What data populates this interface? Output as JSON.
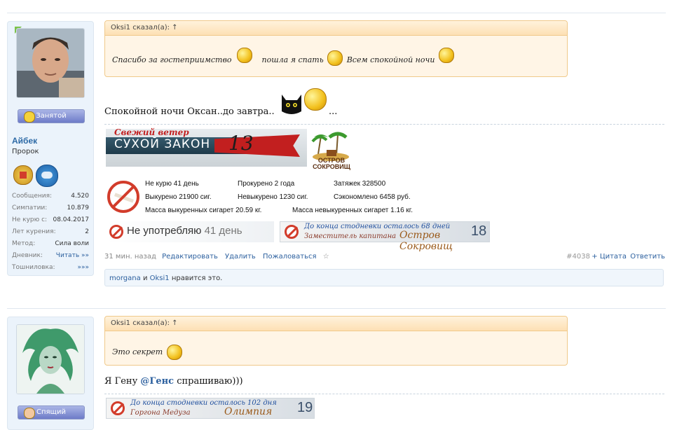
{
  "post1": {
    "user": {
      "status_label": "Занятой",
      "name": "Айбек",
      "title": "Пророк",
      "stats": [
        {
          "label": "Сообщения:",
          "value": "4.520"
        },
        {
          "label": "Симпатии:",
          "value": "10.879"
        },
        {
          "label": "Не курю с:",
          "value": "08.04.2017"
        },
        {
          "label": "Лет курения:",
          "value": "2"
        },
        {
          "label": "Метод:",
          "value": "Сила воли"
        },
        {
          "label": "Дневник:",
          "value": "Читать »»"
        },
        {
          "label": "Тошниловка:",
          "value": "»»»"
        }
      ]
    },
    "quote": {
      "header": "Oksi1 сказал(а): ↑",
      "part1": "Спасибо за гостеприимство",
      "part2": "пошла я спать",
      "part3": "Всем спокойной ночи"
    },
    "message": "Спокойной ночи Оксан..до завтра..",
    "message_tail": "...",
    "banner": {
      "line1": "Свежий ветер",
      "line2": "СУХОЙ ЗАКОН",
      "number": "13",
      "island": "ОСТРОВ СОКРОВИЩ"
    },
    "counter": {
      "c1": "Не курю 41 день",
      "c2": "Прокурено 2 года",
      "c3": "Затяжек 328500",
      "c4": "Выкурено 21900 сиг.",
      "c5": "Невыкурено 1230 сиг.",
      "c6": "Сэкономлено 6458 руб.",
      "c7": "Масса выкуренных сигарет 20.59 кг.",
      "c8": "Масса невыкуренных сигарет 1.16 кг."
    },
    "notuse": {
      "text": "Не употребляю",
      "days": "41 день"
    },
    "stodnevka": {
      "line1": "До конца стодневки осталось 68 дней",
      "line2": "Заместитель капитана",
      "team": "Остров Сокровищ",
      "number": "18"
    },
    "footer": {
      "time": "31 мин. назад",
      "edit": "Редактировать",
      "delete": "Удалить",
      "report": "Пожаловаться",
      "star": "☆",
      "number": "#4038",
      "quote": "+ Цитата",
      "reply": "Ответить"
    },
    "likes": {
      "user1": "morgana",
      "and": "и",
      "user2": "Oksi1",
      "text": "нравится это."
    }
  },
  "post2": {
    "user": {
      "status_label": "Спящий"
    },
    "quote": {
      "header": "Oksi1 сказал(а): ↑",
      "text": "Это секрет"
    },
    "message_pre": "Я Гену",
    "mention": "@Генс",
    "message_post": "спрашиваю)))",
    "stodnevka": {
      "line1": "До конца стодневки осталось 102 дня",
      "line2": "Горгона Медуза",
      "team": "Олимпия",
      "number": "19"
    }
  },
  "colors": {
    "accent_blue": "#2b5f9e",
    "quote_border": "#f0c98a",
    "panel_bg": "#ebf3fb"
  }
}
